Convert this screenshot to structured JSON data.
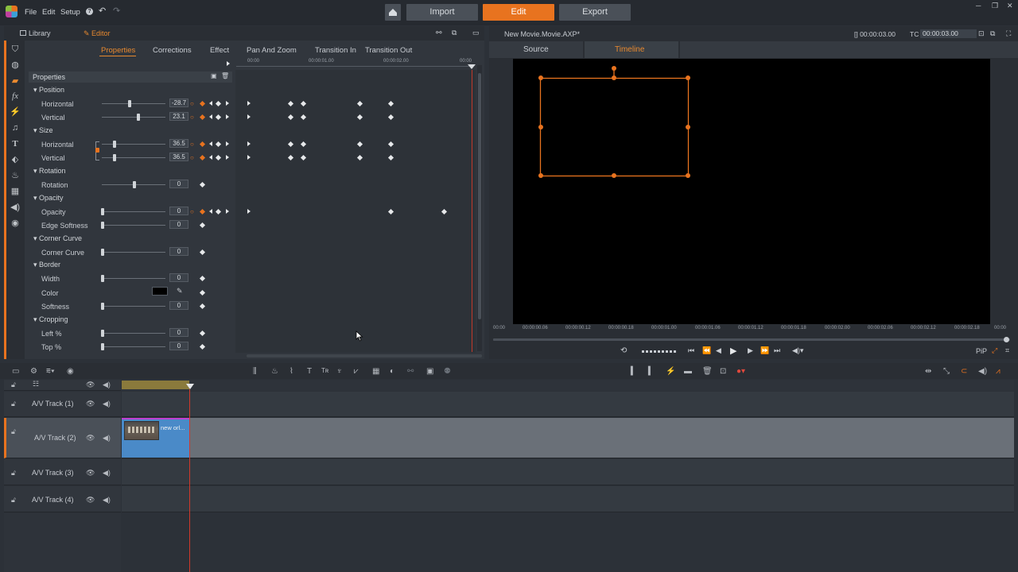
{
  "menu": {
    "file": "File",
    "edit": "Edit",
    "setup": "Setup"
  },
  "topnav": {
    "import": "Import",
    "edit": "Edit",
    "export": "Export"
  },
  "colors": {
    "accent": "#e8731f",
    "panel": "#31363d",
    "preview": "#000000"
  },
  "left_header": {
    "library": "Library",
    "editor": "Editor"
  },
  "tabs": [
    "Properties",
    "Corrections",
    "Effect",
    "Pan And Zoom",
    "Transition In",
    "Transition Out"
  ],
  "section_title": "Properties",
  "groups": {
    "position": "Position",
    "size": "Size",
    "rotation": "Rotation",
    "opacity": "Opacity",
    "corner": "Corner Curve",
    "border": "Border",
    "cropping": "Cropping"
  },
  "rows": {
    "pos_h": {
      "label": "Horizontal",
      "value": "-28.7"
    },
    "pos_v": {
      "label": "Vertical",
      "value": "23.1"
    },
    "size_h": {
      "label": "Horizontal",
      "value": "36.5"
    },
    "size_v": {
      "label": "Vertical",
      "value": "36.5"
    },
    "rot": {
      "label": "Rotation",
      "value": "0"
    },
    "opac": {
      "label": "Opacity",
      "value": "0"
    },
    "edge": {
      "label": "Edge Softness",
      "value": "0"
    },
    "corner": {
      "label": "Corner Curve",
      "value": "0"
    },
    "width": {
      "label": "Width",
      "value": "0"
    },
    "color": {
      "label": "Color"
    },
    "soft": {
      "label": "Softness",
      "value": "0"
    },
    "left": {
      "label": "Left %",
      "value": "0"
    },
    "top": {
      "label": "Top %",
      "value": "0"
    }
  },
  "kf_ruler": [
    "00:00",
    "00:00:01.00",
    "00:00:02.00",
    "00:00"
  ],
  "right_header": {
    "title": "New Movie.Movie.AXP*",
    "duration": "[] 00:00:03.00",
    "tc_label": "TC",
    "tc": "00:00:03.00"
  },
  "right_tabs": {
    "source": "Source",
    "timeline": "Timeline"
  },
  "preview_ruler": [
    "00:00",
    "00:00:00.06",
    "00:00:00.12",
    "00:00:00.18",
    "00:00:01.00",
    "00:00:01.06",
    "00:00:01.12",
    "00:00:01.18",
    "00:00:02.00",
    "00:00:02.06",
    "00:00:02.12",
    "00:00:02.18",
    "00:00"
  ],
  "pip_label": "PiP",
  "tracks": [
    {
      "name": "A/V Track (1)"
    },
    {
      "name": "A/V Track (2)"
    },
    {
      "name": "A/V Track (3)"
    },
    {
      "name": "A/V Track (4)"
    }
  ],
  "clip": {
    "label": "new orl..."
  }
}
